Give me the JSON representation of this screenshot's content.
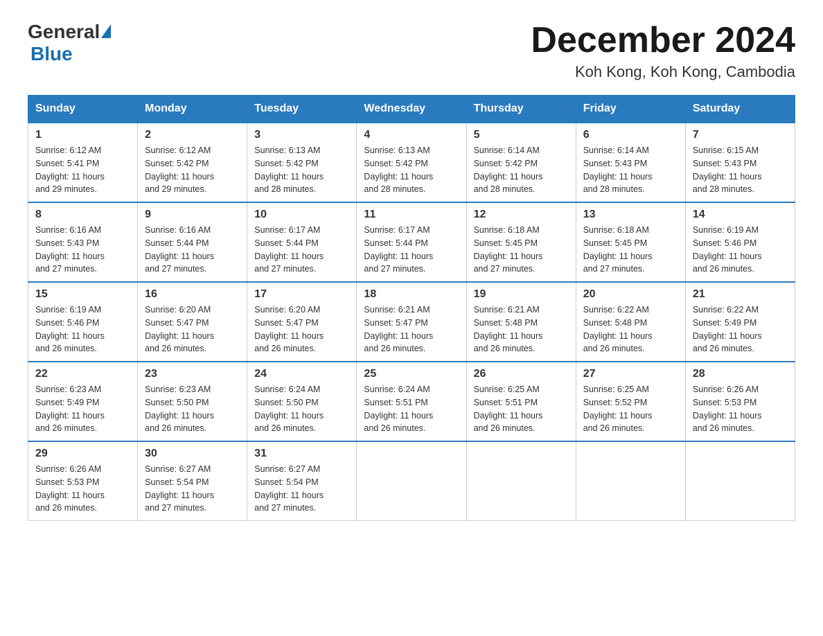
{
  "logo": {
    "general": "General",
    "blue": "Blue"
  },
  "title": "December 2024",
  "location": "Koh Kong, Koh Kong, Cambodia",
  "days_of_week": [
    "Sunday",
    "Monday",
    "Tuesday",
    "Wednesday",
    "Thursday",
    "Friday",
    "Saturday"
  ],
  "weeks": [
    [
      {
        "day": "1",
        "sunrise": "6:12 AM",
        "sunset": "5:41 PM",
        "daylight": "11 hours and 29 minutes."
      },
      {
        "day": "2",
        "sunrise": "6:12 AM",
        "sunset": "5:42 PM",
        "daylight": "11 hours and 29 minutes."
      },
      {
        "day": "3",
        "sunrise": "6:13 AM",
        "sunset": "5:42 PM",
        "daylight": "11 hours and 28 minutes."
      },
      {
        "day": "4",
        "sunrise": "6:13 AM",
        "sunset": "5:42 PM",
        "daylight": "11 hours and 28 minutes."
      },
      {
        "day": "5",
        "sunrise": "6:14 AM",
        "sunset": "5:42 PM",
        "daylight": "11 hours and 28 minutes."
      },
      {
        "day": "6",
        "sunrise": "6:14 AM",
        "sunset": "5:43 PM",
        "daylight": "11 hours and 28 minutes."
      },
      {
        "day": "7",
        "sunrise": "6:15 AM",
        "sunset": "5:43 PM",
        "daylight": "11 hours and 28 minutes."
      }
    ],
    [
      {
        "day": "8",
        "sunrise": "6:16 AM",
        "sunset": "5:43 PM",
        "daylight": "11 hours and 27 minutes."
      },
      {
        "day": "9",
        "sunrise": "6:16 AM",
        "sunset": "5:44 PM",
        "daylight": "11 hours and 27 minutes."
      },
      {
        "day": "10",
        "sunrise": "6:17 AM",
        "sunset": "5:44 PM",
        "daylight": "11 hours and 27 minutes."
      },
      {
        "day": "11",
        "sunrise": "6:17 AM",
        "sunset": "5:44 PM",
        "daylight": "11 hours and 27 minutes."
      },
      {
        "day": "12",
        "sunrise": "6:18 AM",
        "sunset": "5:45 PM",
        "daylight": "11 hours and 27 minutes."
      },
      {
        "day": "13",
        "sunrise": "6:18 AM",
        "sunset": "5:45 PM",
        "daylight": "11 hours and 27 minutes."
      },
      {
        "day": "14",
        "sunrise": "6:19 AM",
        "sunset": "5:46 PM",
        "daylight": "11 hours and 26 minutes."
      }
    ],
    [
      {
        "day": "15",
        "sunrise": "6:19 AM",
        "sunset": "5:46 PM",
        "daylight": "11 hours and 26 minutes."
      },
      {
        "day": "16",
        "sunrise": "6:20 AM",
        "sunset": "5:47 PM",
        "daylight": "11 hours and 26 minutes."
      },
      {
        "day": "17",
        "sunrise": "6:20 AM",
        "sunset": "5:47 PM",
        "daylight": "11 hours and 26 minutes."
      },
      {
        "day": "18",
        "sunrise": "6:21 AM",
        "sunset": "5:47 PM",
        "daylight": "11 hours and 26 minutes."
      },
      {
        "day": "19",
        "sunrise": "6:21 AM",
        "sunset": "5:48 PM",
        "daylight": "11 hours and 26 minutes."
      },
      {
        "day": "20",
        "sunrise": "6:22 AM",
        "sunset": "5:48 PM",
        "daylight": "11 hours and 26 minutes."
      },
      {
        "day": "21",
        "sunrise": "6:22 AM",
        "sunset": "5:49 PM",
        "daylight": "11 hours and 26 minutes."
      }
    ],
    [
      {
        "day": "22",
        "sunrise": "6:23 AM",
        "sunset": "5:49 PM",
        "daylight": "11 hours and 26 minutes."
      },
      {
        "day": "23",
        "sunrise": "6:23 AM",
        "sunset": "5:50 PM",
        "daylight": "11 hours and 26 minutes."
      },
      {
        "day": "24",
        "sunrise": "6:24 AM",
        "sunset": "5:50 PM",
        "daylight": "11 hours and 26 minutes."
      },
      {
        "day": "25",
        "sunrise": "6:24 AM",
        "sunset": "5:51 PM",
        "daylight": "11 hours and 26 minutes."
      },
      {
        "day": "26",
        "sunrise": "6:25 AM",
        "sunset": "5:51 PM",
        "daylight": "11 hours and 26 minutes."
      },
      {
        "day": "27",
        "sunrise": "6:25 AM",
        "sunset": "5:52 PM",
        "daylight": "11 hours and 26 minutes."
      },
      {
        "day": "28",
        "sunrise": "6:26 AM",
        "sunset": "5:53 PM",
        "daylight": "11 hours and 26 minutes."
      }
    ],
    [
      {
        "day": "29",
        "sunrise": "6:26 AM",
        "sunset": "5:53 PM",
        "daylight": "11 hours and 26 minutes."
      },
      {
        "day": "30",
        "sunrise": "6:27 AM",
        "sunset": "5:54 PM",
        "daylight": "11 hours and 27 minutes."
      },
      {
        "day": "31",
        "sunrise": "6:27 AM",
        "sunset": "5:54 PM",
        "daylight": "11 hours and 27 minutes."
      },
      null,
      null,
      null,
      null
    ]
  ],
  "labels": {
    "sunrise": "Sunrise:",
    "sunset": "Sunset:",
    "daylight": "Daylight:"
  }
}
